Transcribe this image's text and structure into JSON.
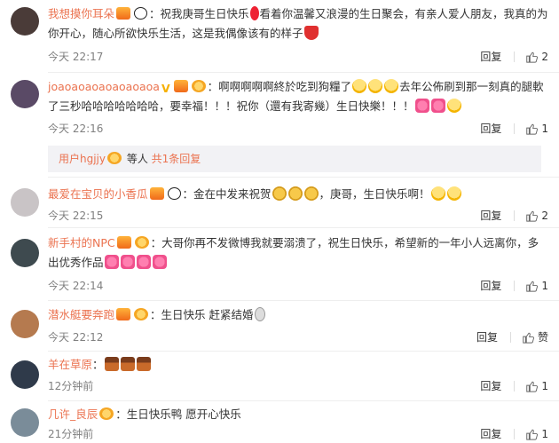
{
  "comments": [
    {
      "user": "我想摸你耳朵",
      "text": "：祝我庚哥生日快乐",
      "text2": "看着你温馨又浪漫的生日聚会，有亲人爱人朋友，我真的为你开心，随心所欲快乐生活，这是我偶像该有的样子",
      "time": "今天 22:17",
      "reply": "回复",
      "likes": "2",
      "avatar_color": "#4a3b38"
    },
    {
      "user": "joaoaoaoaoaoaoaoa",
      "text": "：啊啊啊啊啊終於吃到狗糧了",
      "text2": "去年公佈刷到那一刻真的腿軟了三秒哈哈哈哈哈哈哈，要幸福！！！祝你（還有我寄幾）生日快樂！！！",
      "time": "今天 22:16",
      "reply": "回复",
      "likes": "1",
      "avatar_color": "#5a4a66",
      "subreply": {
        "user": "用户hgjjy",
        "mid": " 等人 ",
        "count": "共1条回复"
      }
    },
    {
      "user": "最爱在宝贝的小香瓜",
      "text": "：金在中发来祝贺",
      "text2": "，庚哥，生日快乐啊！",
      "time": "今天 22:15",
      "reply": "回复",
      "likes": "2",
      "avatar_color": "#c9c4c6"
    },
    {
      "user": "新手村的NPC",
      "text": "：大哥你再不发微博我就要溺溃了，祝生日快乐，希望新的一年小人远离你，多出优秀作品",
      "time": "今天 22:14",
      "reply": "回复",
      "likes": "1",
      "avatar_color": "#3e4a4f"
    },
    {
      "user": "潜水艇要奔跑",
      "text": "：生日快乐 赶紧结婚",
      "time": "今天 22:12",
      "reply": "回复",
      "likes": "赞",
      "avatar_color": "#b57a4f"
    },
    {
      "user": "羊在草原",
      "text": "：",
      "time": "12分钟前",
      "reply": "回复",
      "likes": "1",
      "avatar_color": "#2f3a4a"
    },
    {
      "user": "几许_良辰",
      "text": "：生日快乐鸭   愿开心快乐",
      "time": "21分钟前",
      "reply": "回复",
      "likes": "1",
      "avatar_color": "#7a8c99"
    }
  ]
}
